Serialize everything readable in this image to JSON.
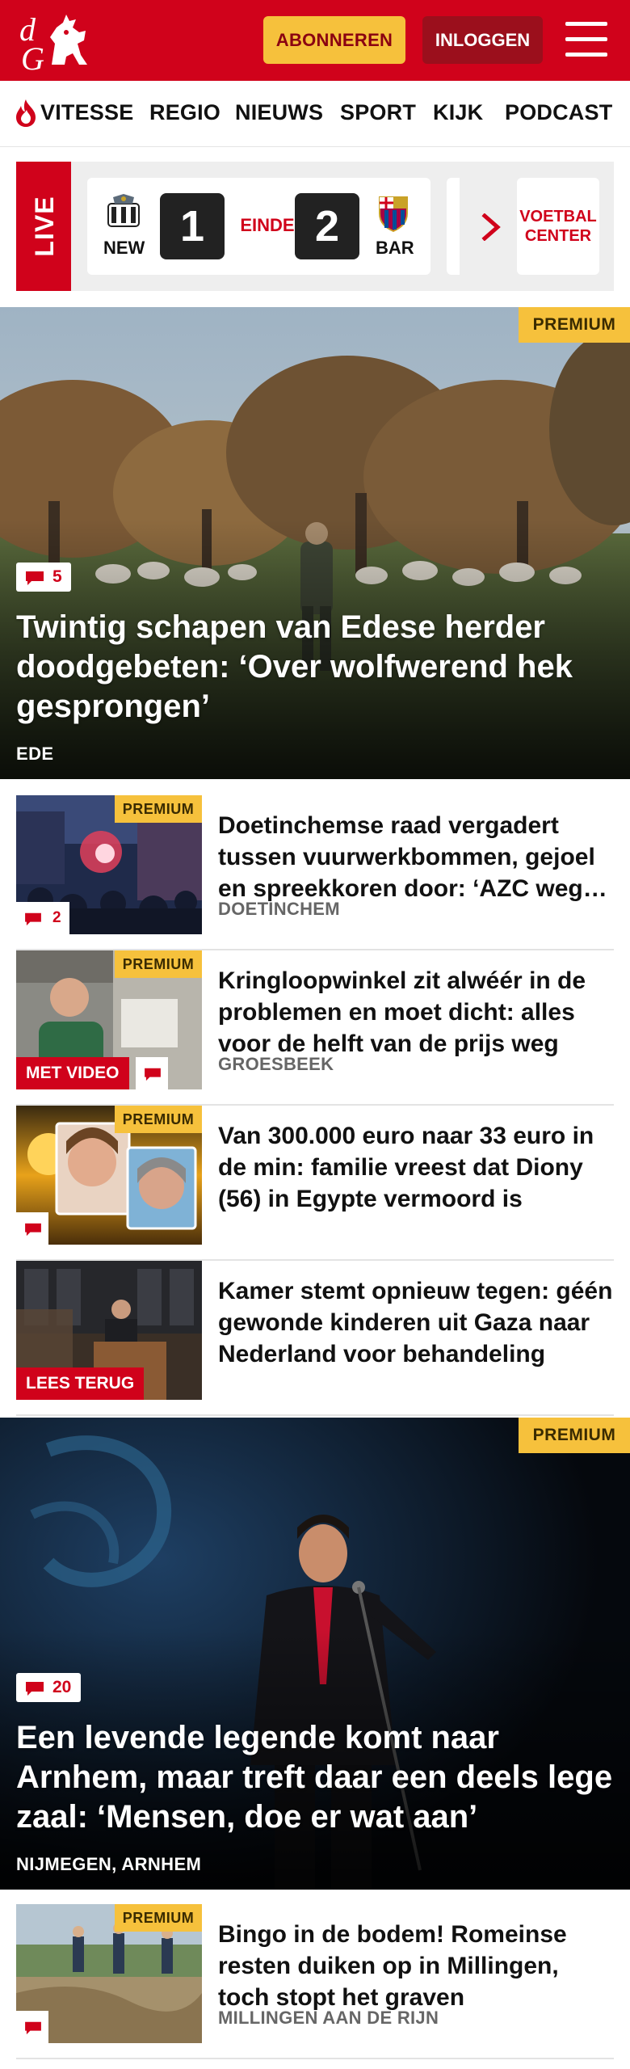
{
  "header": {
    "logo_text": "dG",
    "subscribe_label": "ABONNEREN",
    "login_label": "INLOGGEN"
  },
  "nav": {
    "items": [
      "VITESSE",
      "REGIO",
      "NIEUWS",
      "SPORT",
      "KIJK",
      "PODCAST"
    ]
  },
  "live": {
    "badge": "LIVE",
    "match": {
      "home_code": "NEW",
      "away_code": "BAR",
      "home_score": "1",
      "away_score": "2",
      "status": "EINDE"
    },
    "voetbal_center_line1": "VOETBAL",
    "voetbal_center_line2": "CENTER"
  },
  "hero1": {
    "premium": "PREMIUM",
    "comments": "5",
    "title": "Twintig schapen van Edese herder doodgebeten: ‘Over wolfwerend hek gesprongen’",
    "location": "EDE"
  },
  "articles": [
    {
      "premium": "PREMIUM",
      "comments": "2",
      "title": "Doetinchemse raad vergadert tussen vuurwerkbommen, gejoel en spreekkoren door: ‘AZC weg…",
      "location": "DOETINCHEM"
    },
    {
      "premium": "PREMIUM",
      "label": "MET VIDEO",
      "title": "Kringloopwinkel zit alwéér in de problemen en moet dicht: alles voor de helft van de prijs weg",
      "location": "GROESBEEK"
    },
    {
      "premium": "PREMIUM",
      "title": "Van 300.000 euro naar 33 euro in de min: familie vreest dat Diony (56) in Egypte vermoord is"
    },
    {
      "label": "LEES TERUG",
      "title": "Kamer stemt opnieuw tegen: géén gewonde kinderen uit Gaza naar Nederland voor behandeling"
    }
  ],
  "hero2": {
    "premium": "PREMIUM",
    "comments": "20",
    "title": "Een levende legende komt naar Arnhem, maar treft daar een deels lege zaal: ‘Mensen, doe er wat aan’",
    "location": "NIJMEGEN, ARNHEM"
  },
  "articles2": [
    {
      "premium": "PREMIUM",
      "title": "Bingo in de bodem! Romeinse resten duiken op in Millingen, toch stopt het graven",
      "location": "MILLINGEN AAN DE RIJN"
    }
  ],
  "colors": {
    "brand_red": "#d0021b",
    "premium_yellow": "#f6c13c",
    "login_dark_red": "#9b0f1c"
  }
}
